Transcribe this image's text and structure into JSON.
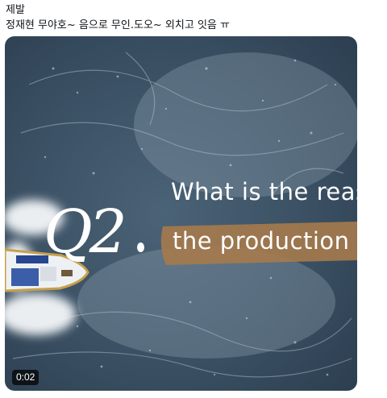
{
  "tweet": {
    "line1": "제발",
    "line2": "정재현 무야호~ 음으로 무인.도오~ 외치고 잇음 ㅠ"
  },
  "video": {
    "question_mark": "Q2",
    "caption_line1": "What is the reas",
    "caption_line2": "the production o",
    "duration": "0:02"
  },
  "colors": {
    "sea": "#3c5266",
    "caption_band": "#a57a4c",
    "text": "#0f1419"
  }
}
